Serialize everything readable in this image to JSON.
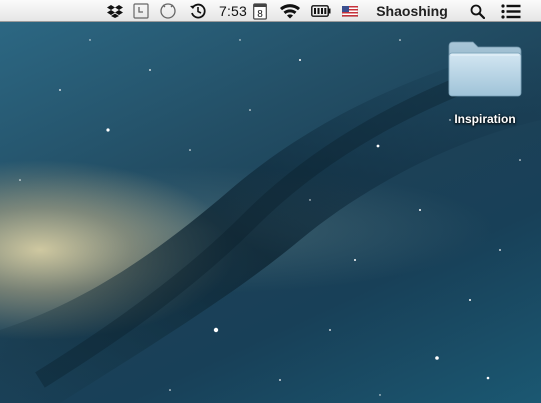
{
  "menubar": {
    "status_items": [
      {
        "icon": "dropbox-icon"
      },
      {
        "icon": "time-machine-icon"
      },
      {
        "icon": "sync-circle-icon"
      },
      {
        "icon": "history-clock-icon"
      },
      {
        "icon": "calendar-icon",
        "value": "8"
      },
      {
        "icon": "wifi-icon"
      },
      {
        "icon": "battery-icon"
      },
      {
        "icon": "us-flag-input-icon"
      }
    ],
    "clock": "7:53",
    "calendar_day": "8",
    "user_name": "Shaoshing"
  },
  "desktop": {
    "folder": {
      "label": "Inspiration",
      "icon": "folder-icon"
    }
  }
}
